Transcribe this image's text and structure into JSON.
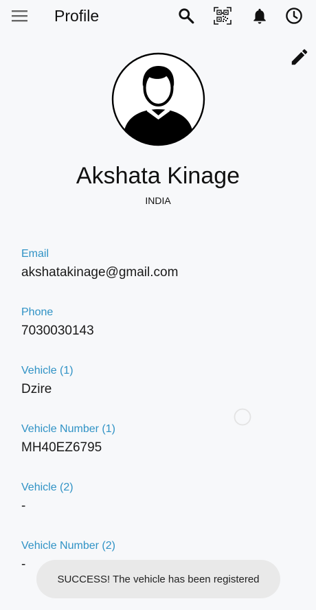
{
  "appbar": {
    "title": "Profile",
    "icons": [
      "menu-icon",
      "search-icon",
      "qr-code-icon",
      "bell-icon",
      "clock-icon"
    ]
  },
  "profile": {
    "name": "Akshata Kinage",
    "country": "INDIA",
    "edit_icon": "pencil-icon",
    "avatar_icon": "person-avatar-icon"
  },
  "fields": [
    {
      "label": "Email",
      "value": "akshatakinage@gmail.com"
    },
    {
      "label": "Phone",
      "value": "7030030143"
    },
    {
      "label": "Vehicle (1)",
      "value": "Dzire"
    },
    {
      "label": "Vehicle Number (1)",
      "value": "MH40EZ6795"
    },
    {
      "label": "Vehicle (2)",
      "value": "-"
    },
    {
      "label": "Vehicle Number (2)",
      "value": "-"
    }
  ],
  "toast": {
    "message": "SUCCESS! The vehicle has been registered"
  },
  "colors": {
    "label_blue": "#2f92c5",
    "background": "#f7f8fa",
    "toast_bg": "#e9e9e9"
  }
}
